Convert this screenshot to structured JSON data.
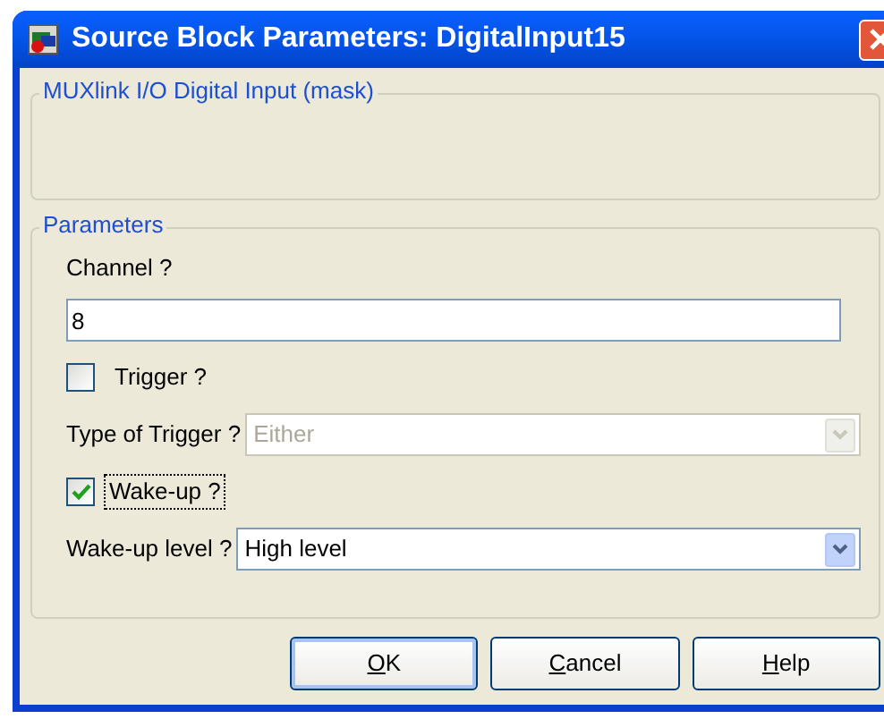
{
  "window": {
    "title": "Source Block Parameters: DigitalInput15"
  },
  "mask_group": {
    "title": "MUXlink I/O Digital Input (mask)"
  },
  "parameters": {
    "title": "Parameters",
    "fields": [
      {
        "kind": "text",
        "label": "Channel ?",
        "value": "8"
      },
      {
        "kind": "checkbox",
        "label": "Trigger ?",
        "checked": false,
        "focused": false
      },
      {
        "kind": "select",
        "label": "Type of Trigger ?",
        "value": "Either",
        "disabled": true
      },
      {
        "kind": "checkbox",
        "label": "Wake-up ?",
        "checked": true,
        "focused": true
      },
      {
        "kind": "select",
        "label": "Wake-up level ?",
        "value": "High level",
        "disabled": false
      }
    ]
  },
  "buttons": [
    {
      "label": "OK",
      "default": true
    },
    {
      "label": "Cancel",
      "default": false
    },
    {
      "label": "Help",
      "default": false
    }
  ]
}
